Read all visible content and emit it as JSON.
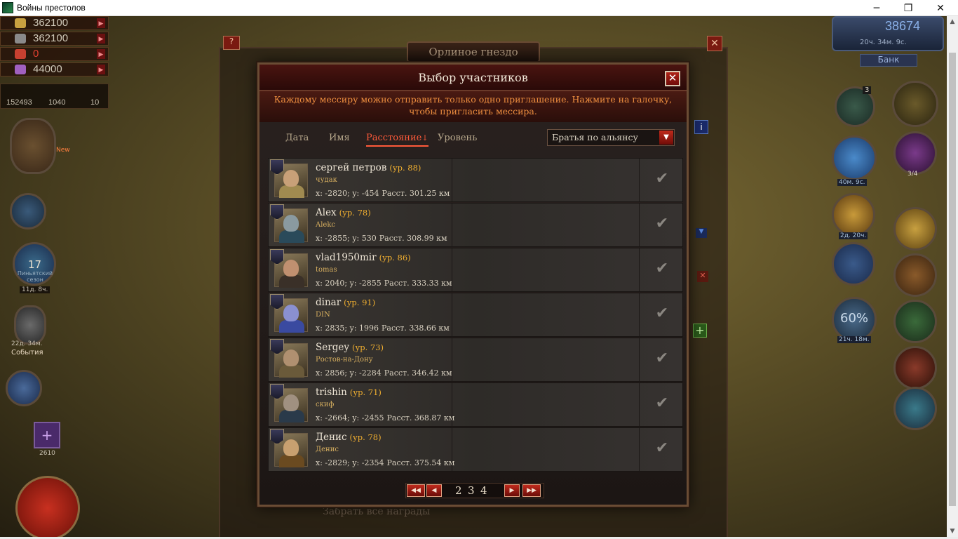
{
  "window": {
    "title": "Войны престолов",
    "minimize": "─",
    "maximize": "❐",
    "close": "✕"
  },
  "resources": [
    {
      "value": "362100",
      "color": "#c8a040"
    },
    {
      "value": "362100",
      "color": "#8a8a8a"
    },
    {
      "value": "0",
      "color": "#c84030"
    },
    {
      "value": "44000",
      "color": "#a060c0"
    }
  ],
  "stats": [
    "152493",
    "1040",
    "10"
  ],
  "background": {
    "window_title": "Орлиное гнездо",
    "gems": "38674",
    "gems_timer": "20ч. 34м. 9с.",
    "bank": "Банк",
    "claim_all": "Забрать все награды",
    "event_level": "17",
    "event_label": "Пиньятский сезон",
    "event_timer": "11д. 8ч.",
    "events_timer": "22д. 34м.",
    "events_label": "События",
    "new_badge": "New",
    "shop_count": "2610",
    "bundle_count": "40м. 9с.",
    "timer_2": "2д. 20ч.",
    "percent": "60%",
    "percent_timer": "21ч. 18м.",
    "counter": "3/4",
    "counter_2": "3"
  },
  "modal": {
    "title": "Выбор участников",
    "close_label": "✕",
    "notice": "Каждому мессиру можно отправить только одно приглашение. Нажмите на галочку, чтобы пригласить мессира.",
    "sort_tabs": [
      "Дата",
      "Имя",
      "Расстояние",
      "Уровень"
    ],
    "active_sort_arrow": "↓",
    "filter": {
      "selected": "Братья по альянсу",
      "arrow": "▼"
    },
    "dist_label": "Расст.",
    "dist_unit": "км",
    "players": [
      {
        "name": "сергей петров",
        "level": "(ур. 88)",
        "alliance": "чудак",
        "coords": "x: -2820; y: -454",
        "distance": "301.25",
        "skin": "#c8a078",
        "outfit": "#a08a50"
      },
      {
        "name": "Alex",
        "level": "(ур. 78)",
        "alliance": "Alekc",
        "coords": "x: -2855; y: 530",
        "distance": "308.99",
        "skin": "#8a9aa0",
        "outfit": "#2a4a5a"
      },
      {
        "name": "vlad1950mir",
        "level": "(ур. 86)",
        "alliance": "tomas",
        "coords": "x: 2040; y: -2855",
        "distance": "333.33",
        "skin": "#c09070",
        "outfit": "#3a3028"
      },
      {
        "name": "dinar",
        "level": "(ур. 91)",
        "alliance": "DIN",
        "coords": "x: 2835; y: 1996",
        "distance": "338.66",
        "skin": "#8a90d0",
        "outfit": "#3a4aa0"
      },
      {
        "name": "Sergey",
        "level": "(ур. 73)",
        "alliance": "Ростов-на-Дону",
        "coords": "x: 2856; y: -2284",
        "distance": "346.42",
        "skin": "#b09070",
        "outfit": "#6a5a3a"
      },
      {
        "name": "trishin",
        "level": "(ур. 71)",
        "alliance": "скиф",
        "coords": "x: -2664; y: -2455",
        "distance": "368.87",
        "skin": "#a09080",
        "outfit": "#2a3a4a"
      },
      {
        "name": "Денис",
        "level": "(ур. 78)",
        "alliance": "Денис",
        "coords": "x: -2829; y: -2354",
        "distance": "375.54",
        "skin": "#c8a070",
        "outfit": "#6a4a20"
      }
    ],
    "pagination": {
      "pages": [
        "2",
        "3",
        "4"
      ],
      "first": "◀◀",
      "prev": "◀",
      "next": "▶",
      "last": "▶▶"
    }
  },
  "scrollbar": {
    "up": "▲",
    "down": "▼"
  }
}
